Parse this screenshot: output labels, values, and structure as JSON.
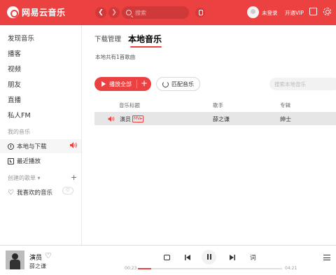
{
  "app": {
    "name": "网易云音乐",
    "accent": "#ec4141"
  },
  "header": {
    "search_placeholder": "搜索",
    "login": "未登录",
    "vip": "开通VIP"
  },
  "sidebar": {
    "items": [
      "发现音乐",
      "播客",
      "视频",
      "朋友",
      "直播",
      "私人FM"
    ],
    "my_music_title": "我的音乐",
    "my_music": [
      {
        "label": "本地与下载",
        "icon": "download-icon",
        "active": true
      },
      {
        "label": "最近播放",
        "icon": "recent-icon"
      }
    ],
    "created_title": "创建的歌单",
    "playlists": [
      {
        "label": "我喜欢的音乐",
        "icon": "heart-icon"
      }
    ]
  },
  "main": {
    "tabs": [
      {
        "label": "下载管理",
        "active": false
      },
      {
        "label": "本地音乐",
        "active": true
      }
    ],
    "count_text": "本地共有1首歌曲",
    "play_all": "播放全部",
    "match": "匹配音乐",
    "local_search_placeholder": "搜索本地音乐",
    "table": {
      "headers": {
        "title": "音乐标题",
        "artist": "歌手",
        "album": "专辑"
      },
      "rows": [
        {
          "title": "演员",
          "badge": "MV▸",
          "artist": "薛之谦",
          "album": "绅士",
          "playing": true
        }
      ]
    }
  },
  "player": {
    "song": "演员",
    "artist": "薛之谦",
    "current_time": "00:23",
    "total_time": "04:21",
    "progress_fraction": 0.09,
    "lyric_label": "词"
  }
}
